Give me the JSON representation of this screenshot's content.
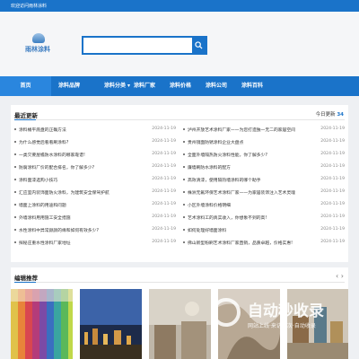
{
  "topbar": {
    "welcome": "欢迎访问雨林涂料"
  },
  "logo": {
    "text": "雨林涂料"
  },
  "search": {
    "placeholder": ""
  },
  "nav": [
    "首页",
    "涂料品牌",
    "涂料分类 ▾",
    "涂料厂家",
    "涂料价格",
    "涂料公司",
    "涂料百科"
  ],
  "latest": {
    "title": "最近更新",
    "today_label": "今日更新",
    "today_count": "34",
    "left": [
      {
        "t": "涂料桶平底盘的正确方法",
        "d": "2024-11-19"
      },
      {
        "t": "为什么感觉后看看刷涂料?",
        "d": "2024-11-19"
      },
      {
        "t": "一类欠要屋檐防水涂料的哪家靠谱!",
        "d": "2024-11-19"
      },
      {
        "t": "防腐涂料厂价的配合排名，你了解多少?",
        "d": "2024-11-19"
      },
      {
        "t": "涂料面漆选购小技巧",
        "d": "2024-11-19"
      },
      {
        "t": "汇应室内装饰面防火涂料，为建筑安全保驾护航",
        "d": "2024-11-19"
      },
      {
        "t": "墙面上涂料的用途和问题",
        "d": "2024-11-19"
      },
      {
        "t": "外墙涂料用用施工安全措施",
        "d": "2024-11-19"
      },
      {
        "t": "水性涂料中异常颜颜的缘和如何有效多少?",
        "d": "2024-11-19"
      },
      {
        "t": "探秘庄重水性涂料厂家地址",
        "d": "2024-11-19"
      }
    ],
    "right": [
      {
        "t": "泸州开放艺术涂料厂家——为您打造独一无二的家居空间",
        "d": "2024-11-19"
      },
      {
        "t": "贵州镜面防锈涂料企业大盘点",
        "d": "2024-11-19"
      },
      {
        "t": "全面外墙隔热防火涂料性能，你了解多少?",
        "d": "2024-11-19"
      },
      {
        "t": "廉墙刷防水涂料的配方",
        "d": "2024-11-19"
      },
      {
        "t": "高效清漆，使用隔热墙涂料的哪个助手",
        "d": "2024-11-19"
      },
      {
        "t": "株洲无氟环保艺术涂料厂家——为家居装饰注入艺术灵魂",
        "d": "2024-11-19"
      },
      {
        "t": "小区外墙涂料价格明细",
        "d": "2024-11-19"
      },
      {
        "t": "艺术涂料工的真实收入，你想象不到的高!",
        "d": "2024-11-19"
      },
      {
        "t": "如何处理好墙面涂料",
        "d": "2024-11-19"
      },
      {
        "t": "佛山新型粉刷艺术涂料厂家直销，品质卓越，价格实惠!",
        "d": "2024-11-19"
      }
    ]
  },
  "featured": {
    "title": "编辑推荐",
    "thumbs": [
      "colored-pencils",
      "city-night",
      "interior-painting",
      "fabric-draping",
      "craft-objects"
    ]
  },
  "watermark": {
    "big": "自动秒收录",
    "small": "网站上线·来访一次·自动收录"
  },
  "colors": {
    "primary": "#1a73c9",
    "nav_active": "#2a86de",
    "background": "#eef0f3"
  }
}
